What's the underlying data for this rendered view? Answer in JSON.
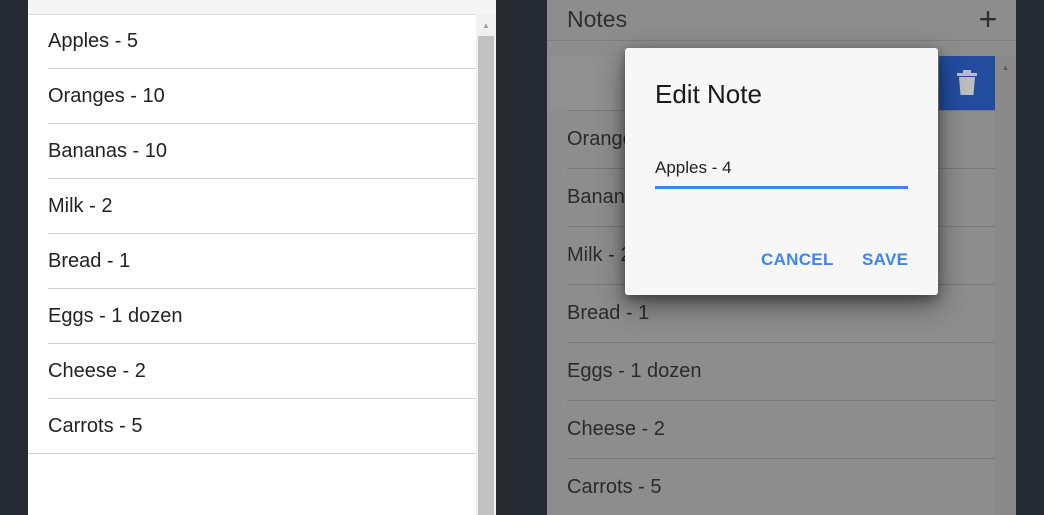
{
  "left_list": {
    "items": [
      "Apples - 5",
      "Oranges - 10",
      "Bananas - 10",
      "Milk - 2",
      "Bread - 1",
      "Eggs - 1 dozen",
      "Cheese - 2",
      "Carrots - 5"
    ]
  },
  "right_app": {
    "title": "Notes",
    "add_icon": "plus-icon",
    "delete_icon": "trash-icon",
    "items": [
      "Orange",
      "Banan",
      "Milk - 2",
      "Bread - 1",
      "Eggs - 1 dozen",
      "Cheese - 2",
      "Carrots - 5"
    ]
  },
  "dialog": {
    "title": "Edit Note",
    "input_value": "Apples - 4",
    "cancel_label": "CANCEL",
    "save_label": "SAVE"
  },
  "colors": {
    "accent": "#3b86f0",
    "delete_action": "#234c9e",
    "desktop": "#262a32"
  }
}
